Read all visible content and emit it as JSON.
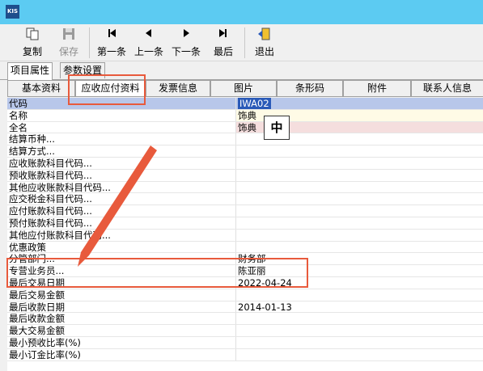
{
  "app": {
    "logo_text": "KIS"
  },
  "toolbar": {
    "copy": "复制",
    "save": "保存",
    "first": "第一条",
    "prev": "上一条",
    "next": "下一条",
    "last": "最后",
    "exit": "退出"
  },
  "top_tabs": [
    "项目属性",
    "参数设置"
  ],
  "sub_tabs": [
    "基本资料",
    "应收应付资料",
    "发票信息",
    "图片",
    "条形码",
    "附件",
    "联系人信息"
  ],
  "grid": {
    "rows": [
      {
        "label": "代码",
        "value": "IWA02"
      },
      {
        "label": "名称",
        "value": "饰典"
      },
      {
        "label": "全名",
        "value": "饰典"
      },
      {
        "label": "结算币种...",
        "value": ""
      },
      {
        "label": "结算方式...",
        "value": ""
      },
      {
        "label": "应收账款科目代码...",
        "value": ""
      },
      {
        "label": "预收账款科目代码...",
        "value": ""
      },
      {
        "label": "其他应收账款科目代码...",
        "value": ""
      },
      {
        "label": "应交税金科目代码...",
        "value": ""
      },
      {
        "label": "应付账款科目代码...",
        "value": ""
      },
      {
        "label": "预付账款科目代码...",
        "value": ""
      },
      {
        "label": "其他应付账款科目代码...",
        "value": ""
      },
      {
        "label": "优惠政策",
        "value": ""
      },
      {
        "label": "分管部门...",
        "value": "财务部"
      },
      {
        "label": "专营业务员...",
        "value": "陈亚丽"
      },
      {
        "label": "最后交易日期",
        "value": "2022-04-24"
      },
      {
        "label": "最后交易金额",
        "value": ""
      },
      {
        "label": "最后收款日期",
        "value": "2014-01-13"
      },
      {
        "label": "最后收款金额",
        "value": ""
      },
      {
        "label": "最大交易金额",
        "value": ""
      },
      {
        "label": "最小预收比率(%)",
        "value": ""
      },
      {
        "label": "最小订金比率(%)",
        "value": ""
      }
    ]
  },
  "ime": {
    "text": "中"
  },
  "colors": {
    "titlebar": "#5ccbf2",
    "highlight": "#e85a3c",
    "header_row": "#b8c7ea",
    "selected_value": "#2a5ab8"
  }
}
